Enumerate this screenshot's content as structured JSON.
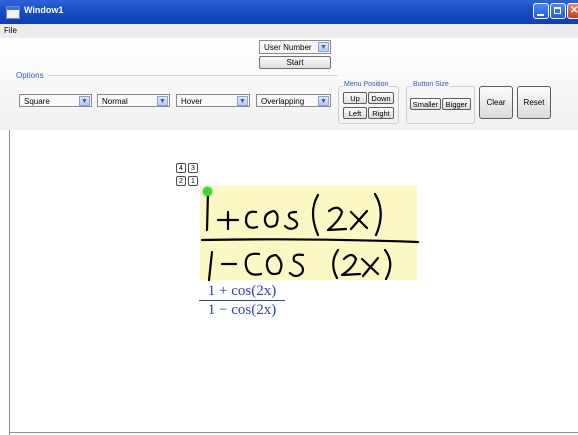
{
  "window": {
    "title": "Window1"
  },
  "menu": {
    "file_label": "File"
  },
  "mode": {
    "selected": "User Number",
    "start_label": "Start"
  },
  "options": {
    "label": "Options",
    "shape": "Square",
    "size": "Normal",
    "activation": "Hover",
    "layout": "Overlapping"
  },
  "menu_position": {
    "label": "Menu Position",
    "up": "Up",
    "down": "Down",
    "left": "Left",
    "right": "Right"
  },
  "button_size": {
    "label": "Button Size",
    "smaller": "Smaller",
    "bigger": "Bigger"
  },
  "actions": {
    "clear": "Clear",
    "reset": "Reset"
  },
  "canvas": {
    "number_buttons": [
      "4",
      "3",
      "2",
      "1"
    ],
    "ink_text": {
      "numerator": "1+cos(2x)",
      "denominator": "1-COS (2x)"
    },
    "recognized": {
      "numerator": "1 + cos(2x)",
      "denominator": "1 − cos(2x)"
    }
  },
  "colors": {
    "title_bar": "#1a4fc7",
    "group_label": "#2b5fb7",
    "ink_background": "#fbf8c3",
    "ink": "#000000",
    "result": "#2c3bc4",
    "pen_dot": "#33dd33"
  }
}
